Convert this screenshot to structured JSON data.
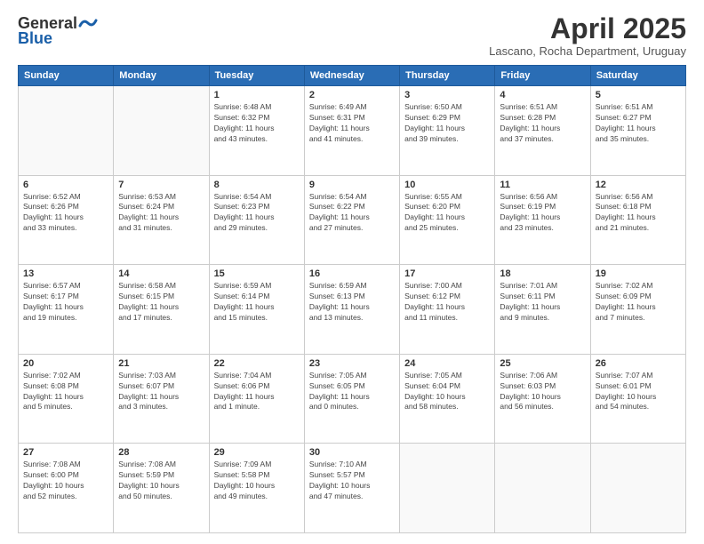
{
  "header": {
    "logo_line1": "General",
    "logo_line2": "Blue",
    "month": "April 2025",
    "location": "Lascano, Rocha Department, Uruguay"
  },
  "weekdays": [
    "Sunday",
    "Monday",
    "Tuesday",
    "Wednesday",
    "Thursday",
    "Friday",
    "Saturday"
  ],
  "weeks": [
    [
      {
        "day": "",
        "info": ""
      },
      {
        "day": "",
        "info": ""
      },
      {
        "day": "1",
        "info": "Sunrise: 6:48 AM\nSunset: 6:32 PM\nDaylight: 11 hours\nand 43 minutes."
      },
      {
        "day": "2",
        "info": "Sunrise: 6:49 AM\nSunset: 6:31 PM\nDaylight: 11 hours\nand 41 minutes."
      },
      {
        "day": "3",
        "info": "Sunrise: 6:50 AM\nSunset: 6:29 PM\nDaylight: 11 hours\nand 39 minutes."
      },
      {
        "day": "4",
        "info": "Sunrise: 6:51 AM\nSunset: 6:28 PM\nDaylight: 11 hours\nand 37 minutes."
      },
      {
        "day": "5",
        "info": "Sunrise: 6:51 AM\nSunset: 6:27 PM\nDaylight: 11 hours\nand 35 minutes."
      }
    ],
    [
      {
        "day": "6",
        "info": "Sunrise: 6:52 AM\nSunset: 6:26 PM\nDaylight: 11 hours\nand 33 minutes."
      },
      {
        "day": "7",
        "info": "Sunrise: 6:53 AM\nSunset: 6:24 PM\nDaylight: 11 hours\nand 31 minutes."
      },
      {
        "day": "8",
        "info": "Sunrise: 6:54 AM\nSunset: 6:23 PM\nDaylight: 11 hours\nand 29 minutes."
      },
      {
        "day": "9",
        "info": "Sunrise: 6:54 AM\nSunset: 6:22 PM\nDaylight: 11 hours\nand 27 minutes."
      },
      {
        "day": "10",
        "info": "Sunrise: 6:55 AM\nSunset: 6:20 PM\nDaylight: 11 hours\nand 25 minutes."
      },
      {
        "day": "11",
        "info": "Sunrise: 6:56 AM\nSunset: 6:19 PM\nDaylight: 11 hours\nand 23 minutes."
      },
      {
        "day": "12",
        "info": "Sunrise: 6:56 AM\nSunset: 6:18 PM\nDaylight: 11 hours\nand 21 minutes."
      }
    ],
    [
      {
        "day": "13",
        "info": "Sunrise: 6:57 AM\nSunset: 6:17 PM\nDaylight: 11 hours\nand 19 minutes."
      },
      {
        "day": "14",
        "info": "Sunrise: 6:58 AM\nSunset: 6:15 PM\nDaylight: 11 hours\nand 17 minutes."
      },
      {
        "day": "15",
        "info": "Sunrise: 6:59 AM\nSunset: 6:14 PM\nDaylight: 11 hours\nand 15 minutes."
      },
      {
        "day": "16",
        "info": "Sunrise: 6:59 AM\nSunset: 6:13 PM\nDaylight: 11 hours\nand 13 minutes."
      },
      {
        "day": "17",
        "info": "Sunrise: 7:00 AM\nSunset: 6:12 PM\nDaylight: 11 hours\nand 11 minutes."
      },
      {
        "day": "18",
        "info": "Sunrise: 7:01 AM\nSunset: 6:11 PM\nDaylight: 11 hours\nand 9 minutes."
      },
      {
        "day": "19",
        "info": "Sunrise: 7:02 AM\nSunset: 6:09 PM\nDaylight: 11 hours\nand 7 minutes."
      }
    ],
    [
      {
        "day": "20",
        "info": "Sunrise: 7:02 AM\nSunset: 6:08 PM\nDaylight: 11 hours\nand 5 minutes."
      },
      {
        "day": "21",
        "info": "Sunrise: 7:03 AM\nSunset: 6:07 PM\nDaylight: 11 hours\nand 3 minutes."
      },
      {
        "day": "22",
        "info": "Sunrise: 7:04 AM\nSunset: 6:06 PM\nDaylight: 11 hours\nand 1 minute."
      },
      {
        "day": "23",
        "info": "Sunrise: 7:05 AM\nSunset: 6:05 PM\nDaylight: 11 hours\nand 0 minutes."
      },
      {
        "day": "24",
        "info": "Sunrise: 7:05 AM\nSunset: 6:04 PM\nDaylight: 10 hours\nand 58 minutes."
      },
      {
        "day": "25",
        "info": "Sunrise: 7:06 AM\nSunset: 6:03 PM\nDaylight: 10 hours\nand 56 minutes."
      },
      {
        "day": "26",
        "info": "Sunrise: 7:07 AM\nSunset: 6:01 PM\nDaylight: 10 hours\nand 54 minutes."
      }
    ],
    [
      {
        "day": "27",
        "info": "Sunrise: 7:08 AM\nSunset: 6:00 PM\nDaylight: 10 hours\nand 52 minutes."
      },
      {
        "day": "28",
        "info": "Sunrise: 7:08 AM\nSunset: 5:59 PM\nDaylight: 10 hours\nand 50 minutes."
      },
      {
        "day": "29",
        "info": "Sunrise: 7:09 AM\nSunset: 5:58 PM\nDaylight: 10 hours\nand 49 minutes."
      },
      {
        "day": "30",
        "info": "Sunrise: 7:10 AM\nSunset: 5:57 PM\nDaylight: 10 hours\nand 47 minutes."
      },
      {
        "day": "",
        "info": ""
      },
      {
        "day": "",
        "info": ""
      },
      {
        "day": "",
        "info": ""
      }
    ]
  ]
}
